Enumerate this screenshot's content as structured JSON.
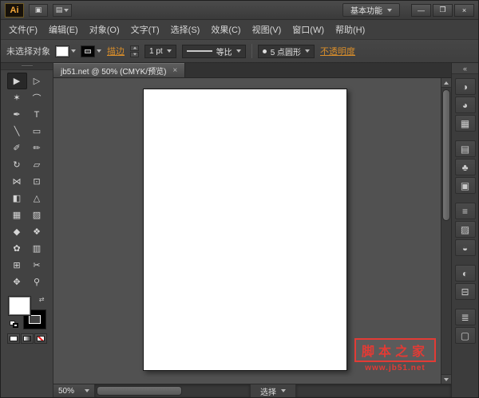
{
  "window": {
    "logo": "Ai",
    "bridge_icon_glyph": "▣",
    "arrange_icon_glyph": "▤",
    "workspace_button": "基本功能",
    "minimize_glyph": "—",
    "restore_glyph": "❐",
    "close_glyph": "×"
  },
  "menubar": {
    "items": [
      "文件(F)",
      "编辑(E)",
      "对象(O)",
      "文字(T)",
      "选择(S)",
      "效果(C)",
      "视图(V)",
      "窗口(W)",
      "帮助(H)"
    ]
  },
  "controlbar": {
    "status_label": "未选择对象",
    "stroke_link": "描边",
    "stroke_weight": "1 pt",
    "profile_label": "等比",
    "brush_label": "5 点圆形",
    "opacity_link": "不透明度",
    "collapse_glyph": "«"
  },
  "tabbar": {
    "document_title": "jb51.net @ 50% (CMYK/预览)",
    "close_glyph": "×"
  },
  "tools": [
    {
      "name": "selection",
      "glyph": "▶",
      "selected": true
    },
    {
      "name": "direct-selection",
      "glyph": "▷"
    },
    {
      "name": "magic-wand",
      "glyph": "✶"
    },
    {
      "name": "lasso",
      "glyph": "⌒"
    },
    {
      "name": "pen",
      "glyph": "✒"
    },
    {
      "name": "type",
      "glyph": "T"
    },
    {
      "name": "line-segment",
      "glyph": "╲"
    },
    {
      "name": "rectangle",
      "glyph": "▭"
    },
    {
      "name": "paintbrush",
      "glyph": "✐"
    },
    {
      "name": "pencil",
      "glyph": "✏"
    },
    {
      "name": "rotate",
      "glyph": "↻"
    },
    {
      "name": "scale",
      "glyph": "▱"
    },
    {
      "name": "width",
      "glyph": "⋈"
    },
    {
      "name": "free-transform",
      "glyph": "⊡"
    },
    {
      "name": "shape-builder",
      "glyph": "◧"
    },
    {
      "name": "perspective-grid",
      "glyph": "△"
    },
    {
      "name": "mesh",
      "glyph": "▦"
    },
    {
      "name": "gradient",
      "glyph": "▨"
    },
    {
      "name": "eyedropper",
      "glyph": "◆"
    },
    {
      "name": "blend",
      "glyph": "❖"
    },
    {
      "name": "symbol-sprayer",
      "glyph": "✿"
    },
    {
      "name": "column-graph",
      "glyph": "▥"
    },
    {
      "name": "artboard",
      "glyph": "⊞"
    },
    {
      "name": "slice",
      "glyph": "✂"
    },
    {
      "name": "hand",
      "glyph": "✥"
    },
    {
      "name": "zoom",
      "glyph": "⚲"
    }
  ],
  "dock_icons": [
    {
      "name": "color-panel",
      "glyph": "◑"
    },
    {
      "name": "color-guide-panel",
      "glyph": "◕"
    },
    {
      "name": "swatches-panel",
      "glyph": "▦",
      "group_end": true
    },
    {
      "name": "brushes-panel",
      "glyph": "▤"
    },
    {
      "name": "symbols-panel",
      "glyph": "♣"
    },
    {
      "name": "graphic-styles-panel",
      "glyph": "▣",
      "group_end": true
    },
    {
      "name": "stroke-panel",
      "glyph": "≡"
    },
    {
      "name": "gradient-panel",
      "glyph": "▨"
    },
    {
      "name": "transparency-panel",
      "glyph": "◒",
      "group_end": true
    },
    {
      "name": "appearance-panel",
      "glyph": "◐"
    },
    {
      "name": "align-panel",
      "glyph": "⊟",
      "group_end": true
    },
    {
      "name": "layers-panel",
      "glyph": "≣"
    },
    {
      "name": "artboards-panel",
      "glyph": "▢"
    }
  ],
  "statusbar": {
    "zoom": "50%",
    "tool_status": "选择"
  },
  "watermark": {
    "title": "脚本之家",
    "url": "www.jb51.net"
  },
  "colors": {
    "accent_orange": "#d98e2b",
    "watermark_red": "#e23b35",
    "artboard_white": "#ffffff"
  }
}
